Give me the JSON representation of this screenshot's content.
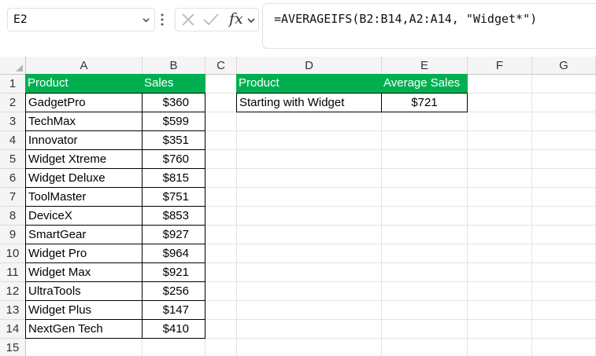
{
  "formula_bar": {
    "name_box": "E2",
    "formula": "=AVERAGEIFS(B2:B14,A2:A14, \"Widget*\")",
    "fx_label": "fx"
  },
  "columns": [
    "A",
    "B",
    "C",
    "D",
    "E",
    "F",
    "G"
  ],
  "rows": [
    "1",
    "2",
    "3",
    "4",
    "5",
    "6",
    "7",
    "8",
    "9",
    "10",
    "11",
    "12",
    "13",
    "14",
    "15"
  ],
  "table1": {
    "headers": [
      "Product",
      "Sales"
    ],
    "rows": [
      [
        "GadgetPro",
        "$360"
      ],
      [
        "TechMax",
        "$599"
      ],
      [
        "Innovator",
        "$351"
      ],
      [
        "Widget Xtreme",
        "$760"
      ],
      [
        "Widget Deluxe",
        "$815"
      ],
      [
        "ToolMaster",
        "$751"
      ],
      [
        "DeviceX",
        "$853"
      ],
      [
        "SmartGear",
        "$927"
      ],
      [
        "Widget Pro",
        "$964"
      ],
      [
        "Widget Max",
        "$921"
      ],
      [
        "UltraTools",
        "$256"
      ],
      [
        "Widget Plus",
        "$147"
      ],
      [
        "NextGen Tech",
        "$410"
      ]
    ]
  },
  "table2": {
    "headers": [
      "Product",
      "Average Sales"
    ],
    "row": [
      "Starting with Widget",
      "$721"
    ]
  },
  "colors": {
    "header_fill": "#00b050",
    "header_text": "#ffffff"
  }
}
